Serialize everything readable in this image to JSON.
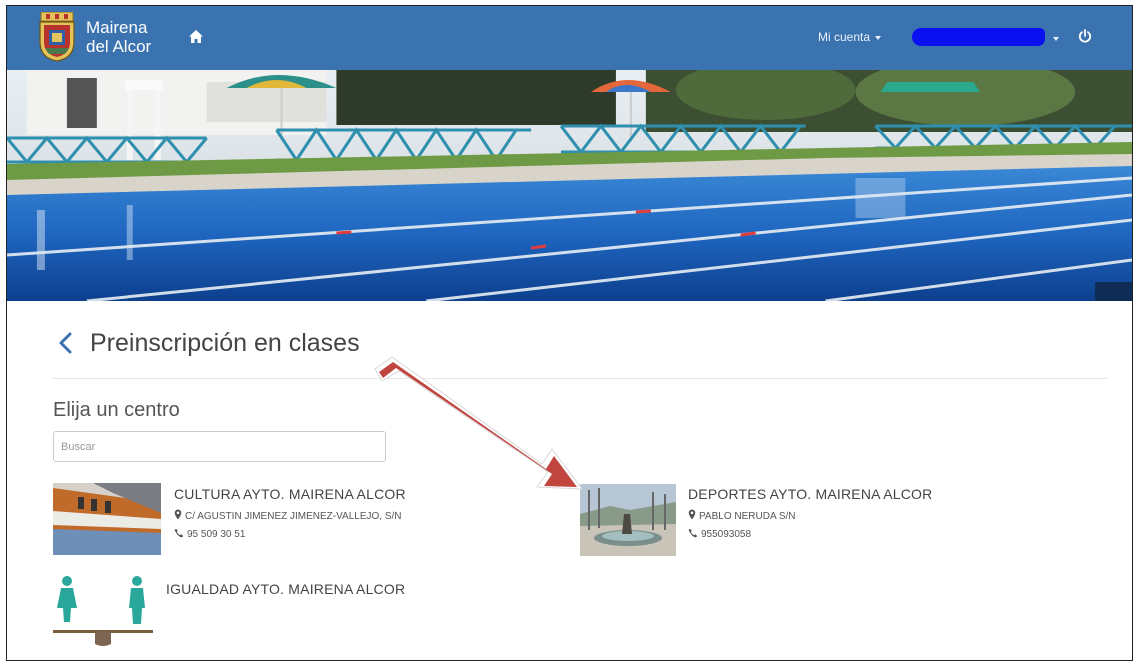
{
  "header": {
    "brand_line1": "Mairena",
    "brand_line2": "del Alcor",
    "account_label": "Mi cuenta",
    "brand_color": "#3a73b0"
  },
  "page": {
    "title": "Preinscripción en clases",
    "subtitle": "Elija un centro"
  },
  "search": {
    "placeholder": "Buscar",
    "value": ""
  },
  "centers": [
    {
      "name": "CULTURA AYTO. MAIRENA ALCOR",
      "address": "C/ AGUSTIN JIMENEZ JIMENEZ-VALLEJO, S/N",
      "phone": "95 509 30 51"
    },
    {
      "name": "DEPORTES AYTO. MAIRENA ALCOR",
      "address": "PABLO NERUDA S/N",
      "phone": "955093058"
    },
    {
      "name": "IGUALDAD AYTO. MAIRENA ALCOR"
    }
  ],
  "icons": {
    "home": "home-icon",
    "power": "power-icon",
    "back": "chevron-left-icon",
    "address": "map-marker-icon",
    "phone": "phone-icon"
  },
  "annotation_color": "#c0453f"
}
